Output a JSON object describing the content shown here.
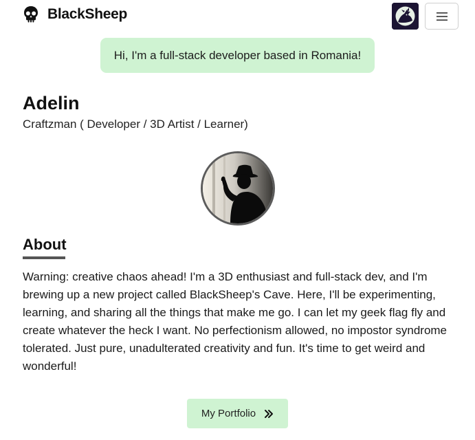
{
  "header": {
    "brand_name": "BlackSheep",
    "brand_icon": "skull-icon",
    "avatar_icon": "hooded-figure-avatar",
    "menu_icon": "hamburger-menu-icon"
  },
  "greeting": {
    "text": "Hi, I'm a full-stack developer based in Romania!"
  },
  "profile": {
    "name": "Adelin",
    "role": "Craftzman ( Developer / 3D Artist / Learner)",
    "photo_icon": "silhouette-portrait"
  },
  "about": {
    "title": "About",
    "body": "Warning: creative chaos ahead! I'm a 3D enthusiast and full-stack dev, and I'm brewing up a new project called BlackSheep's Cave. Here, I'll be experimenting, learning, and sharing all the things that make me go. I can let my geek flag fly and create whatever the heck I want. No perfectionism allowed, no impostor syndrome tolerated. Just pure, unadulterated creativity and fun. It's time to get weird and wonderful!"
  },
  "cta": {
    "label": "My Portfolio",
    "icon": "double-chevron-right-icon"
  },
  "colors": {
    "accent_green": "#cff3d2",
    "avatar_bg": "#1c1433",
    "text": "#111111"
  }
}
